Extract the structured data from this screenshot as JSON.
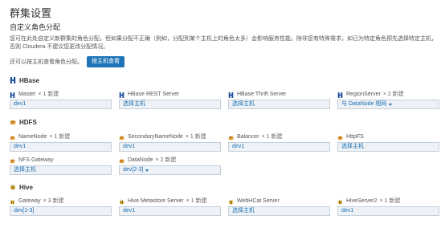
{
  "header": {
    "title": "群集设置",
    "subtitle": "自定义角色分配"
  },
  "intro": {
    "description": "您可在此处自定义新群集的角色分配，但如果分配不正确（例如，分配到某个主机上的角色太多）会影响服务性能。除非您有特殊需求，如已为特定角色预先选择特定主机，否则 Cloudera 不建议您更改分配情况。",
    "view_by_host_text": "还可以按主机查看角色分配。",
    "view_by_host_button": "按主机查看"
  },
  "colors": {
    "heading": "#333333",
    "text": "#555555",
    "muted": "#666666",
    "link": "#1a6fb4",
    "button": "#1f75b8",
    "box_bg": "#eef2f6",
    "box_border": "#c5cfd9",
    "hbase": "#1d4f9e",
    "hdfs": "#e9a53c",
    "hive": "#f4c430"
  },
  "services": [
    {
      "name": "HBase",
      "icon": "hbase-icon",
      "roles": [
        {
          "name": "Master",
          "count": "× 1 新建",
          "host": "dev1"
        },
        {
          "name": "HBase REST Server",
          "host": "选择主机"
        },
        {
          "name": "HBase Thrift Server",
          "host": "选择主机"
        },
        {
          "name": "RegionServer",
          "count": "× 2 新建",
          "host": "与 DataNode 相同",
          "icon": "caret-down-icon"
        }
      ]
    },
    {
      "name": "HDFS",
      "icon": "hdfs-icon",
      "roles": [
        {
          "name": "NameNode",
          "count": "× 1 新建",
          "host": "dev1"
        },
        {
          "name": "SecondaryNameNode",
          "count": "× 1 新建",
          "host": "dev1"
        },
        {
          "name": "Balancer",
          "count": "× 1 新建",
          "host": "dev1"
        },
        {
          "name": "HttpFS",
          "host": "选择主机"
        },
        {
          "name": "NFS Gateway",
          "host": "选择主机"
        },
        {
          "name": "DataNode",
          "count": "× 2 新建",
          "host": "dev[2-3]",
          "icon": "caret-down-icon"
        }
      ]
    },
    {
      "name": "Hive",
      "icon": "hive-icon",
      "roles": [
        {
          "name": "Gateway",
          "count": "× 3 新建",
          "host": "dev[1-3]"
        },
        {
          "name": "Hive Metastore Server",
          "count": "× 1 新建",
          "host": "dev1"
        },
        {
          "name": "WebHCat Server",
          "host": "选择主机"
        },
        {
          "name": "HiveServer2",
          "count": "× 1 新建",
          "host": "dev1"
        }
      ]
    }
  ]
}
